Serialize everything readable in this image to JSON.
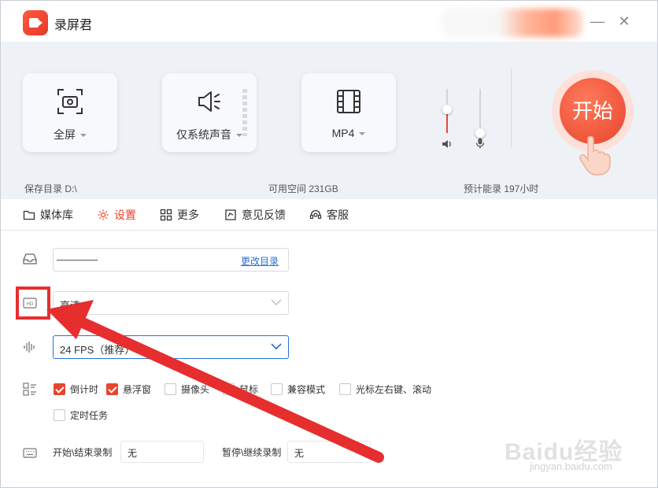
{
  "app": {
    "title": "录屏君"
  },
  "cards": {
    "screen": {
      "label": "全屏",
      "icon": "screen-capture-icon"
    },
    "audio": {
      "label": "仅系统声音",
      "icon": "speaker-icon"
    },
    "format": {
      "label": "MP4",
      "icon": "film-icon"
    }
  },
  "volume": {
    "speaker_icon": "speaker-icon",
    "mic_icon": "microphone-icon"
  },
  "start": {
    "label": "开始"
  },
  "info": {
    "save_dir": "保存目录  D:\\",
    "free_space": "可用空间  231GB",
    "est_time": "预计能录  197小时"
  },
  "tabs": [
    {
      "label": "媒体库",
      "icon": "folder-icon"
    },
    {
      "label": "设置",
      "icon": "gear-icon"
    },
    {
      "label": "更多",
      "icon": "grid-icon"
    },
    {
      "label": "意见反馈",
      "icon": "feedback-icon"
    },
    {
      "label": "客服",
      "icon": "headset-icon"
    }
  ],
  "settings": {
    "dir_change_label": "更改目录",
    "quality_value": "高清",
    "fps_value": "24 FPS（推荐）",
    "options": [
      {
        "label": "倒计时",
        "checked": true
      },
      {
        "label": "悬浮窗",
        "checked": true
      },
      {
        "label": "摄像头",
        "checked": false
      },
      {
        "label": "鼠标",
        "checked": false
      },
      {
        "label": "兼容模式",
        "checked": false
      },
      {
        "label": "光标左右键、滚动",
        "checked": false
      },
      {
        "label": "定时任务",
        "checked": false
      }
    ],
    "hotkeys": {
      "start_stop_label": "开始\\结束录制",
      "start_stop_value": "无",
      "pause_resume_label": "暂停\\继续录制",
      "pause_resume_value": "无"
    }
  },
  "watermark": {
    "text": "Baidu经验",
    "sub": "jingyan.baidu.com"
  },
  "colors": {
    "accent": "#e8442e",
    "link": "#2b6fd6",
    "annotation": "#e62e2e"
  }
}
